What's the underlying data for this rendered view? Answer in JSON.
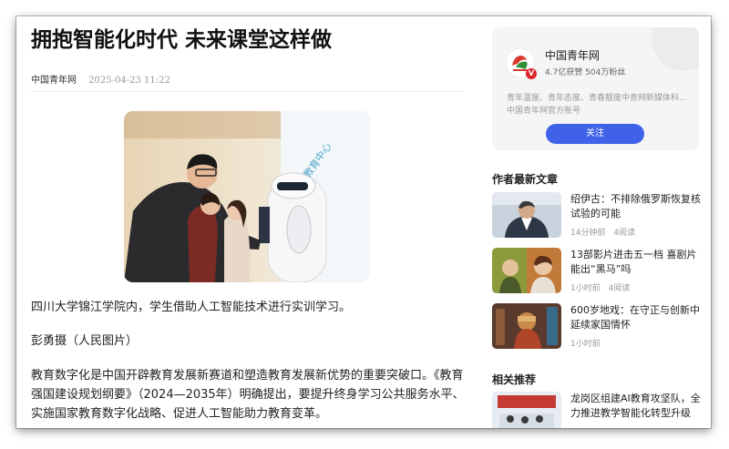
{
  "article": {
    "title": "拥抱智能化时代 未来课堂这样做",
    "source": "中国青年网",
    "time": "2025-04-23 11:22",
    "image_caption": "四川大学锦江学院内，学生借助人工智能技术进行实训学习。",
    "photographer": "彭勇摄（人民图片）",
    "body": "教育数字化是中国开辟教育发展新赛道和塑造教育发展新优势的重要突破口。《教育强国建设规划纲要》（2024—2035年）明确提出，要提升终身学习公共服务水平、实施国家教育数字化战略、促进人工智能助力教育变革。"
  },
  "author_card": {
    "name": "中国青年网",
    "stats": "4.7亿获赞 504万粉丝",
    "description": "青年温度、青年态度、青春靓度中青网新媒体科...",
    "account": "中国青年网官方账号",
    "follow_label": "关注",
    "verified_mark": "V",
    "accent": "#3f62e8"
  },
  "latest": {
    "heading": "作者最新文章",
    "items": [
      {
        "title": "绍伊古：不排除俄罗斯恢复核试验的可能",
        "time": "14分钟前",
        "reads": "4阅读"
      },
      {
        "title": "13部影片进击五一档 喜剧片能出“黑马”吗",
        "time": "1小时前",
        "reads": "4阅读"
      },
      {
        "title": "600岁地戏：在守正与创新中延续家国情怀",
        "time": "1小时前",
        "reads": ""
      }
    ]
  },
  "related": {
    "heading": "相关推荐",
    "items": [
      {
        "title": "龙岗区组建AI教育攻坚队，全力推进教学智能化转型升级"
      }
    ]
  }
}
